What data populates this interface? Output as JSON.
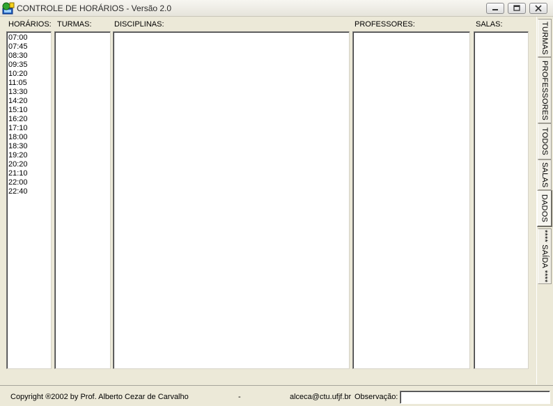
{
  "window": {
    "title": "CONTROLE DE HORÁRIOS - Versão 2.0"
  },
  "columns": {
    "horarios": "HORÁRIOS:",
    "turmas": "TURMAS:",
    "disciplinas": "DISCIPLINAS:",
    "professores": "PROFESSORES:",
    "salas": "SALAS:"
  },
  "horarios": [
    "07:00",
    "07:45",
    "08:30",
    "09:35",
    "10:20",
    "11:05",
    "13:30",
    "14:20",
    "15:10",
    "16:20",
    "17:10",
    "18:00",
    "18:30",
    "19:20",
    "20:20",
    "21:10",
    "22:00",
    "22:40"
  ],
  "tabs": [
    "TURMAS",
    "PROFESSORES",
    "TODOS",
    "SALAS",
    "DADOS",
    "**** SAÍDA ****"
  ],
  "active_tab": "DADOS",
  "status": {
    "copyright": "Copyright ®2002 by Prof. Alberto Cezar de Carvalho",
    "separator": "-",
    "email": "alceca@ctu.ufjf.br",
    "observacao_label": "Observação:",
    "observacao_value": ""
  }
}
